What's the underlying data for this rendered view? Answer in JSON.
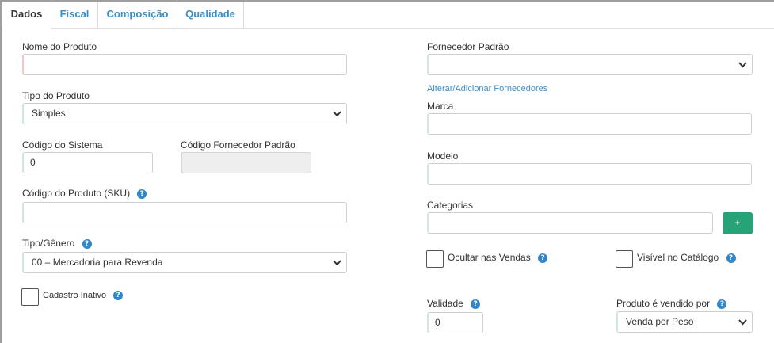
{
  "tabs": [
    {
      "label": "Dados",
      "active": true
    },
    {
      "label": "Fiscal",
      "active": false
    },
    {
      "label": "Composição",
      "active": false
    },
    {
      "label": "Qualidade",
      "active": false
    }
  ],
  "left": {
    "nome_produto": {
      "label": "Nome do Produto",
      "value": ""
    },
    "tipo_produto": {
      "label": "Tipo do Produto",
      "selected": "Simples"
    },
    "codigo_sistema": {
      "label": "Código do Sistema",
      "value": "0"
    },
    "codigo_fornecedor": {
      "label": "Código Fornecedor Padrão",
      "value": ""
    },
    "codigo_sku": {
      "label": "Código do Produto (SKU)",
      "value": ""
    },
    "tipo_genero": {
      "label": "Tipo/Gênero",
      "selected": "00 – Mercadoria para Revenda"
    },
    "cadastro_inativo": {
      "label": "Cadastro Inativo",
      "checked": false
    }
  },
  "right": {
    "fornecedor_padrao": {
      "label": "Fornecedor Padrão",
      "selected": ""
    },
    "alterar_fornecedores_link": "Alterar/Adicionar Fornecedores",
    "marca": {
      "label": "Marca",
      "value": ""
    },
    "modelo": {
      "label": "Modelo",
      "value": ""
    },
    "categorias": {
      "label": "Categorias",
      "value": "",
      "add_label": "+"
    },
    "ocultar_vendas": {
      "label": "Ocultar nas Vendas",
      "checked": false
    },
    "visivel_catalogo": {
      "label": "Visível no Catálogo",
      "checked": false
    },
    "validade": {
      "label": "Validade",
      "value": "0"
    },
    "vendido_por": {
      "label": "Produto é vendido por",
      "selected": "Venda por Peso"
    }
  },
  "icons": {
    "help": "?"
  },
  "colors": {
    "link": "#3a8fc8",
    "help": "#2f86c9",
    "add_button": "#26a377"
  }
}
